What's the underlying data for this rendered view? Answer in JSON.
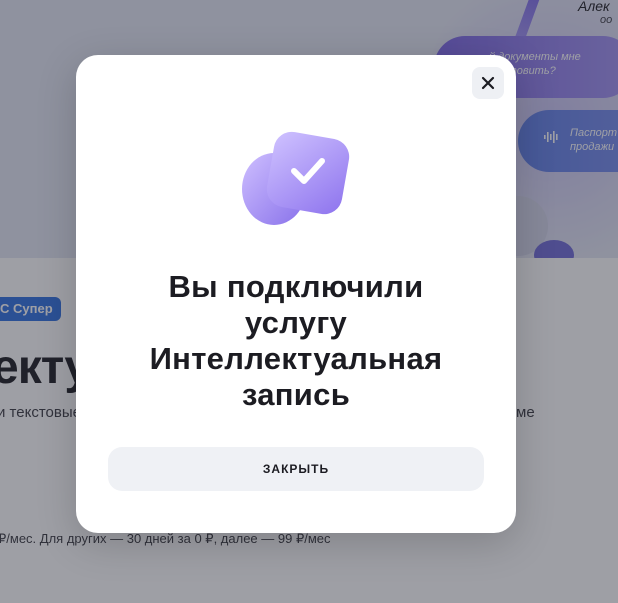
{
  "background": {
    "user_name": "Алек",
    "user_sub": "оо",
    "bubble_1_text": [
      "…й документы мне",
      "подготовить?"
    ],
    "bubble_2_text": [
      "Паспорт",
      "продажи"
    ],
    "badge": "С Супер",
    "title_fragment": "екту",
    "description_left": "и текстовые",
    "description_right": "ме",
    "price_line": "₽/мес. Для других — 30 дней за 0 ₽, далее — 99 ₽/мес",
    "icons": [
      "sound-wave-icon"
    ]
  },
  "modal": {
    "title_lines": [
      "Вы подключили",
      "услугу",
      "Интеллектуальная",
      "запись"
    ],
    "close_icon": "close-icon",
    "illustration_icon": "checkmark-card-icon",
    "button_label": "ЗАКРЫТЬ"
  },
  "colors": {
    "overlay": "#282a38",
    "accent_purple": "#8b79ec",
    "badge_blue": "#2f6fe0",
    "button_bg": "#eff1f5"
  }
}
